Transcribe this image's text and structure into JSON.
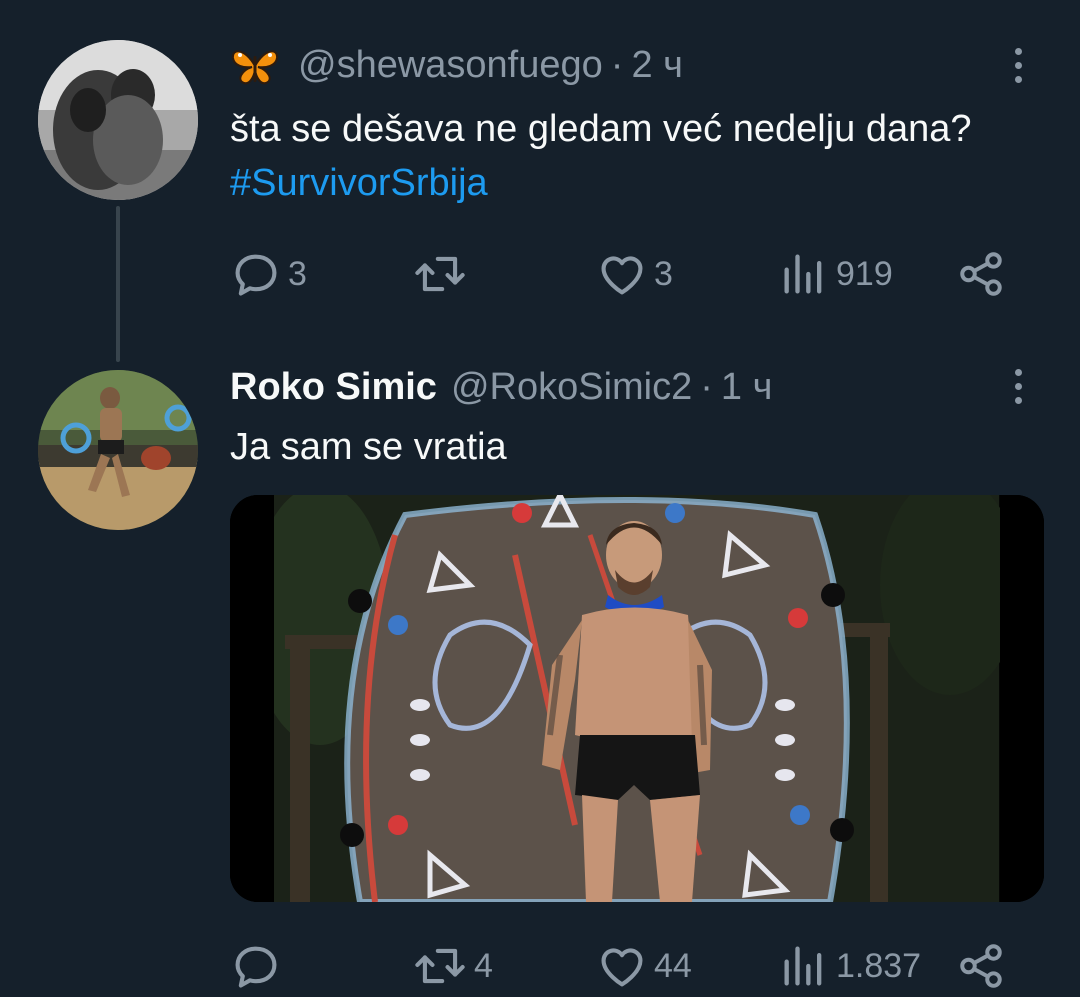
{
  "tweets": [
    {
      "handle": "@shewasonfuego",
      "separator": "·",
      "time": "2 ч",
      "text_plain": "šta se dešava ne gledam već nedelju dana?",
      "hashtag": "#SurvivorSrbija",
      "actions": {
        "replies": "3",
        "retweets": "",
        "likes": "3",
        "views": "919"
      },
      "emoji_icon": "butterfly-icon"
    },
    {
      "display_name": "Roko Simic",
      "handle": "@RokoSimic2",
      "separator": "·",
      "time": "1 ч",
      "text": "Ja sam se vratia",
      "actions": {
        "replies": "",
        "retweets": "4",
        "likes": "44",
        "views": "1.837"
      },
      "media": "photo"
    }
  ],
  "colors": {
    "background": "#15202b",
    "text_primary": "#f7f9f9",
    "text_secondary": "#8b98a5",
    "link": "#1d9bf0",
    "thread_line": "#38444d"
  },
  "icons": [
    "reply-icon",
    "retweet-icon",
    "like-icon",
    "views-icon",
    "share-icon",
    "more-icon",
    "butterfly-icon"
  ]
}
